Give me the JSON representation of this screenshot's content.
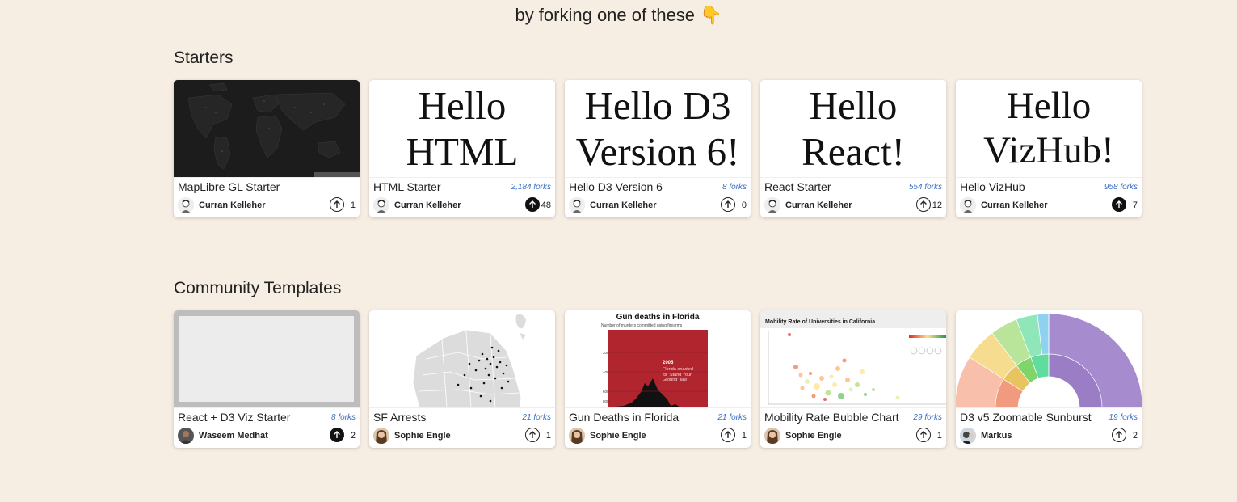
{
  "tagline": "by forking one of these 👇",
  "sections": {
    "starters": {
      "title": "Starters",
      "cards": [
        {
          "title": "MapLibre GL Starter",
          "forks": "",
          "author": "Curran Kelleher",
          "upvotes": "1",
          "upvoted": false,
          "thumb_text": ""
        },
        {
          "title": "HTML Starter",
          "forks": "2,184 forks",
          "author": "Curran Kelleher",
          "upvotes": "48",
          "upvoted": true,
          "thumb_text": "Hello HTML"
        },
        {
          "title": "Hello D3 Version 6",
          "forks": "8 forks",
          "author": "Curran Kelleher",
          "upvotes": "0",
          "upvoted": false,
          "thumb_text": "Hello D3 Version 6!"
        },
        {
          "title": "React Starter",
          "forks": "554 forks",
          "author": "Curran Kelleher",
          "upvotes": "12",
          "upvoted": false,
          "thumb_text": "Hello React!"
        },
        {
          "title": "Hello VizHub",
          "forks": "958 forks",
          "author": "Curran Kelleher",
          "upvotes": "7",
          "upvoted": true,
          "thumb_text": "Hello VizHub!"
        }
      ]
    },
    "community": {
      "title": "Community Templates",
      "cards": [
        {
          "title": "React + D3 Viz Starter",
          "forks": "8 forks",
          "author": "Waseem Medhat",
          "upvotes": "2",
          "upvoted": true
        },
        {
          "title": "SF Arrests",
          "forks": "21 forks",
          "author": "Sophie Engle",
          "upvotes": "1",
          "upvoted": false
        },
        {
          "title": "Gun Deaths in Florida",
          "forks": "21 forks",
          "author": "Sophie Engle",
          "upvotes": "1",
          "upvoted": false,
          "thumb": {
            "title": "Gun deaths in Florida",
            "subtitle": "Number of murders committed using firearms",
            "annotation_year": "2005",
            "annotation_lines": [
              "Florida enacted",
              "its \"Stand Your",
              "Ground\" law"
            ],
            "ticks": [
              "200",
              "400",
              "600",
              "800"
            ]
          }
        },
        {
          "title": "Mobility Rate Bubble Chart",
          "forks": "29 forks",
          "author": "Sophie Engle",
          "upvotes": "1",
          "upvoted": false,
          "thumb": {
            "title": "Mobility Rate of Universities in California"
          }
        },
        {
          "title": "D3 v5 Zoomable Sunburst",
          "forks": "19 forks",
          "author": "Markus",
          "upvotes": "2",
          "upvoted": false
        }
      ]
    }
  },
  "colors": {
    "background": "#f6ede3",
    "forks_link": "#3a6fc4",
    "florida_red": "#b0252e",
    "sunburst_purple": "#a78bcf"
  }
}
